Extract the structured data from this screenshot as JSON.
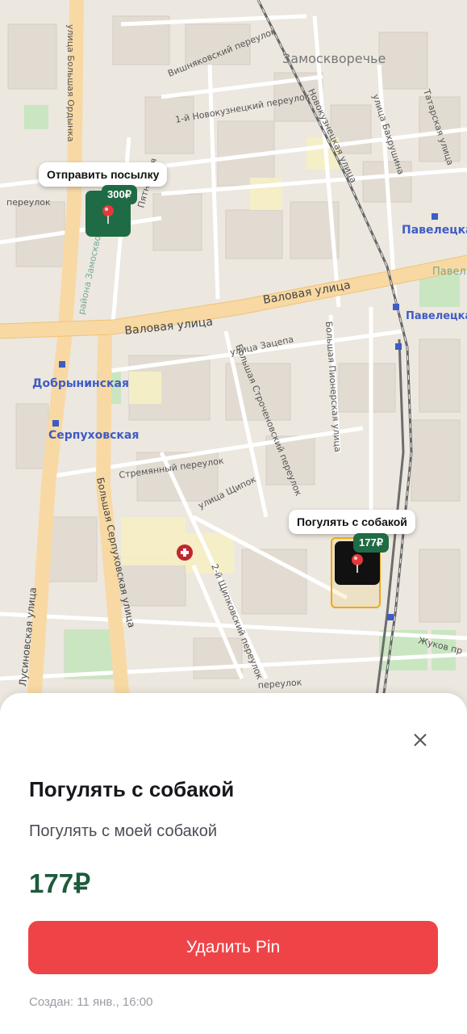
{
  "map": {
    "district_label": "Замоскворечье",
    "streets": [
      "Вишняковский переулок",
      "1-й Новокузнецкий переулок",
      "улица Большая Ордынка",
      "Новокузнецкая улица",
      "улица Бахрушина",
      "Татарская улица",
      "Пятницкая",
      "Валовая улица",
      "Валовая улица",
      "улица Зацепа",
      "Большая Строченовский переулок",
      "Большая Пионерская улица",
      "Стремянный переулок",
      "Большая Серпуховская улица",
      "Лусиновская улица",
      "улица Щипок",
      "2-й Щипковский переулок",
      "Жуков пр",
      "переулок",
      "переулок",
      "Павел",
      "района Замоскворечье"
    ],
    "stations": [
      "Добрынинская",
      "Серпуховская",
      "Павелецкая",
      "Павелецкая"
    ]
  },
  "pins": [
    {
      "label": "Отправить посылку",
      "price": "300₽",
      "color": "#1f6b45"
    },
    {
      "label": "Погулять с собакой",
      "price": "177₽",
      "color": "#111111",
      "selected": true,
      "selected_border": "#f0a90f"
    }
  ],
  "sheet": {
    "close_icon": "close-icon",
    "title": "Погулять с собакой",
    "description": "Погулять с моей собакой",
    "price": "177₽",
    "delete_button": "Удалить Pin",
    "created": "Создан: 11 янв., 16:00",
    "accent": "#1e5a3c",
    "danger": "#ee4448"
  }
}
